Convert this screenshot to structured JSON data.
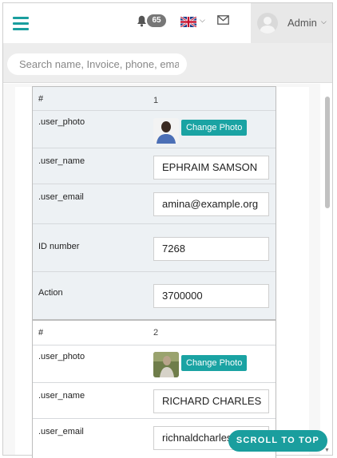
{
  "header": {
    "notification_count": "65",
    "language": "English (UK)",
    "user_label": "Admin"
  },
  "search": {
    "placeholder": "Search name, Invoice, phone, email"
  },
  "records": [
    {
      "index_label": "#",
      "index_value": "1",
      "photo_label": ".user_photo",
      "photo_button": "Change Photo",
      "name_label": ".user_name",
      "name_value": "EPHRAIM SAMSON",
      "email_label": ".user_email",
      "email_value": "amina@example.org",
      "id_label": "ID number",
      "id_value": "7268",
      "action_label": "Action",
      "action_value": "3700000"
    },
    {
      "index_label": "#",
      "index_value": "2",
      "photo_label": ".user_photo",
      "photo_button": "Change Photo",
      "name_label": ".user_name",
      "name_value": "RICHARD CHARLES",
      "email_label": ".user_email",
      "email_value": "richnaldcharles@example.org"
    }
  ],
  "scroll_top_label": "SCROLL TO TOP",
  "colors": {
    "accent": "#1a9e9e",
    "button": "#1aa3a3",
    "badge": "#777777",
    "card_highlight": "#edf1f4"
  },
  "icons": {
    "menu": "hamburger-menu-icon",
    "notifications": "bell-icon",
    "language": "uk-flag-icon",
    "messages": "envelope-icon",
    "user": "user-avatar-icon"
  }
}
